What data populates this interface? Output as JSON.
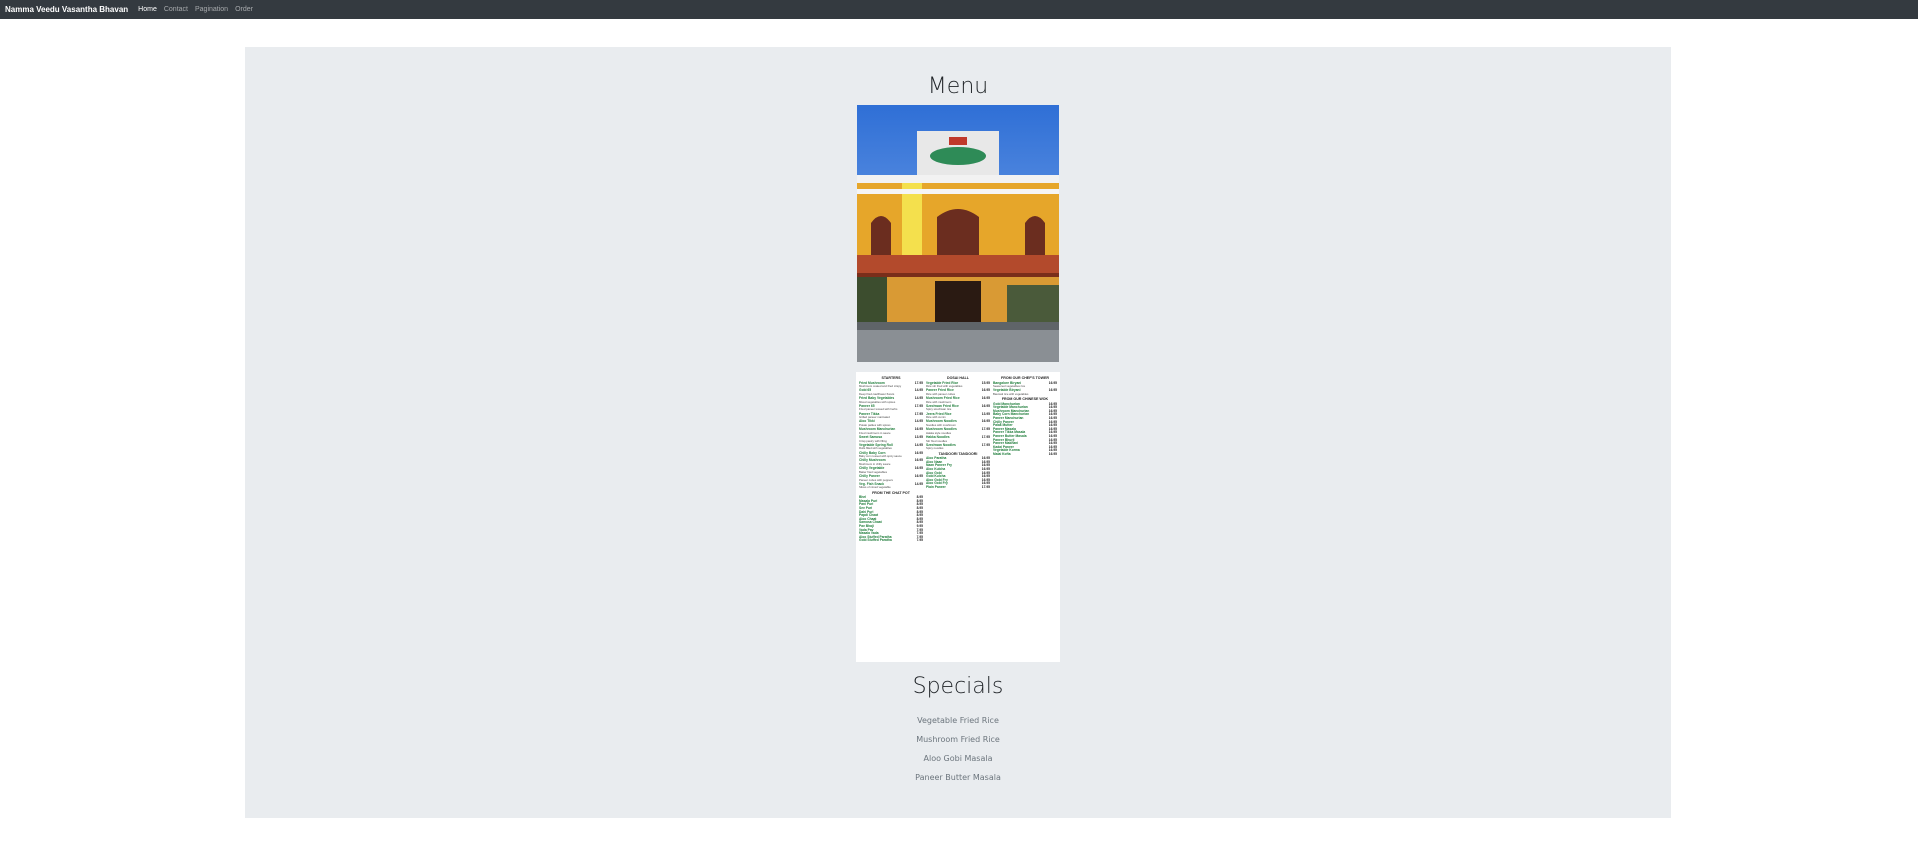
{
  "navbar": {
    "brand": "Namma Veedu Vasantha Bhavan",
    "links": [
      {
        "label": "Home",
        "active": true
      },
      {
        "label": "Contact",
        "active": false
      },
      {
        "label": "Pagination",
        "active": false
      },
      {
        "label": "Order",
        "active": false
      }
    ]
  },
  "main": {
    "menu_heading": "Menu",
    "specials_heading": "Specials",
    "specials": [
      "Vegetable Fried Rice",
      "Mushroom Fried Rice",
      "Aloo Gobi Masala",
      "Paneer Butter Masala"
    ]
  },
  "menu_card": {
    "columns": [
      {
        "title": "STARTERS",
        "items": [
          {
            "name": "Fried Mushroom",
            "price": "17.95",
            "desc": "Mushroom coated and fried crispy"
          },
          {
            "name": "Gobi 65",
            "price": "14.95",
            "desc": "Deep fried cauliflower florets"
          },
          {
            "name": "Fried Baby Vegetables",
            "price": "14.95",
            "desc": "Mixed vegetables with spices"
          },
          {
            "name": "Paneer 65",
            "price": "17.95",
            "desc": "Fried paneer tossed with herbs"
          },
          {
            "name": "Paneer Tikka",
            "price": "17.95",
            "desc": "Grilled paneer marinated"
          },
          {
            "name": "Aloo Tikki",
            "price": "14.95",
            "desc": "Potato patties with spices"
          },
          {
            "name": "Mushroom Manchurian",
            "price": "16.95",
            "desc": "Fried mushroom in sauce"
          },
          {
            "name": "Sweet Samosa",
            "price": "13.95",
            "desc": "Crisp pastry with filling"
          },
          {
            "name": "Vegetable Spring Roll",
            "price": "14.95",
            "desc": "Rolls filled with vegetables"
          },
          {
            "name": "Chilly Baby Corn",
            "price": "16.95",
            "desc": "Baby corn tossed with spicy sauce"
          },
          {
            "name": "Chilly Mushroom",
            "price": "16.95",
            "desc": "Mushroom in chilly sauce"
          },
          {
            "name": "Chilly Vegetable",
            "price": "16.95",
            "desc": "Batter fried vegetables"
          },
          {
            "name": "Chilly Paneer",
            "price": "16.95",
            "desc": "Paneer cubes with peppers"
          },
          {
            "name": "Veg. Fish Snack",
            "price": "14.95",
            "desc": "Slices of mixed vegetable"
          }
        ],
        "subtitle": "FROM THE CHAT POT",
        "subitems": [
          {
            "name": "Bhel",
            "price": "8.95"
          },
          {
            "name": "Masala Puri",
            "price": "8.95"
          },
          {
            "name": "Pani Puri",
            "price": "8.95"
          },
          {
            "name": "Sev Puri",
            "price": "8.95"
          },
          {
            "name": "Dahi Puri",
            "price": "8.95"
          },
          {
            "name": "Papdi Chaat",
            "price": "8.95"
          },
          {
            "name": "Aloo Chaat",
            "price": "8.95"
          },
          {
            "name": "Samosa Chaat",
            "price": "8.95"
          },
          {
            "name": "Pav Bhaji",
            "price": "9.95"
          },
          {
            "name": "Vada Pav",
            "price": "7.95"
          },
          {
            "name": "Masala Vada",
            "price": "7.95"
          },
          {
            "name": "Aloo Stuffed Paratha",
            "price": "7.95"
          },
          {
            "name": "Gobi Stuffed Paratha",
            "price": "7.95"
          }
        ]
      },
      {
        "title": "DOSAI HALL",
        "items": [
          {
            "name": "Vegetable Fried Rice",
            "price": "15.95",
            "desc": "Rice stir fried with vegetables"
          },
          {
            "name": "Paneer Fried Rice",
            "price": "16.95",
            "desc": "Rice with paneer cubes"
          },
          {
            "name": "Mushroom Fried Rice",
            "price": "16.95",
            "desc": "Rice with mushroom"
          },
          {
            "name": "Szechwan Fried Rice",
            "price": "16.95",
            "desc": "Spicy szechwan rice"
          },
          {
            "name": "Jeera Fried Rice",
            "price": "13.95",
            "desc": "Rice with cumin"
          },
          {
            "name": "Mushroom Noodles",
            "price": "16.95",
            "desc": "Noodles with mushroom"
          },
          {
            "name": "Mushroom Noodles",
            "price": "17.95",
            "desc": "Hakka style noodles"
          },
          {
            "name": "Hakka Noodles",
            "price": "17.95",
            "desc": "Stir fried noodles"
          },
          {
            "name": "Szechwan Noodles",
            "price": "17.95",
            "desc": "Spicy noodles"
          }
        ],
        "subtitle": "TANDOORI TANDOORI",
        "subitems": [
          {
            "name": "Aloo Paratha",
            "price": "16.95"
          },
          {
            "name": "Aloo Naan",
            "price": "16.95"
          },
          {
            "name": "Naan Paneer Fry",
            "price": "16.95"
          },
          {
            "name": "Aloo Kulcha",
            "price": "16.95"
          },
          {
            "name": "Aloo Gobi",
            "price": "16.95"
          },
          {
            "name": "Gobi Kulcha",
            "price": "16.95"
          },
          {
            "name": "Aloo Gobi Fry",
            "price": "16.95"
          },
          {
            "name": "Aloo Gobi Fry",
            "price": "16.95"
          },
          {
            "name": "Plain Paneer",
            "price": "17.95"
          }
        ]
      },
      {
        "title": "FROM OUR CHEF'S TOWER",
        "items": [
          {
            "name": "Bangalore Biryani",
            "price": "16.95",
            "desc": "Seasoned vegetables rice"
          },
          {
            "name": "Vegetable Biryani",
            "price": "16.95",
            "desc": "Basmati rice with vegetables"
          }
        ],
        "subtitle": "FROM OUR CHINESE WOK",
        "subitems": [
          {
            "name": "Gobi Manchurian",
            "price": "16.95"
          },
          {
            "name": "Vegetable Manchurian",
            "price": "16.95"
          },
          {
            "name": "Mushroom Manchurian",
            "price": "16.95"
          },
          {
            "name": "Baby Corn Manchurian",
            "price": "16.95"
          },
          {
            "name": "Paneer Manchurian",
            "price": "16.95"
          },
          {
            "name": "Chilly Paneer",
            "price": "16.95"
          },
          {
            "name": "Palak Mutter",
            "price": "16.95"
          },
          {
            "name": "Paneer Masala",
            "price": "16.95"
          },
          {
            "name": "Paneer Tikka Masala",
            "price": "16.95"
          },
          {
            "name": "Paneer Butter Masala",
            "price": "16.95"
          },
          {
            "name": "Paneer Bhurji",
            "price": "16.95"
          },
          {
            "name": "Paneer Makhani",
            "price": "16.95"
          },
          {
            "name": "Kadai Paneer",
            "price": "16.95"
          },
          {
            "name": "Vegetable Korma",
            "price": "16.95"
          },
          {
            "name": "Malai Kofta",
            "price": "16.95"
          }
        ]
      }
    ]
  }
}
